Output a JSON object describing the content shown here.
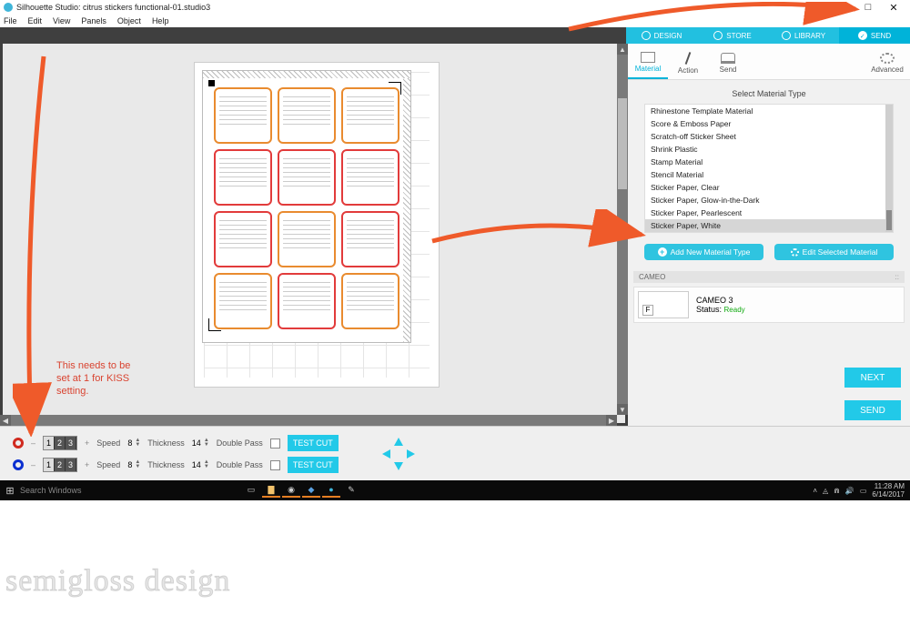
{
  "title": "Silhouette Studio: citrus stickers functional-01.studio3",
  "menubar": [
    "File",
    "Edit",
    "View",
    "Panels",
    "Object",
    "Help"
  ],
  "nav_tabs": [
    "DESIGN",
    "STORE",
    "LIBRARY",
    "SEND"
  ],
  "panel_tabs": {
    "material": "Material",
    "action": "Action",
    "send": "Send",
    "advanced": "Advanced"
  },
  "material": {
    "header": "Select Material Type",
    "items": [
      "Rhinestone Template Material",
      "Score & Emboss Paper",
      "Scratch-off Sticker Sheet",
      "Shrink Plastic",
      "Stamp Material",
      "Stencil Material",
      "Sticker Paper, Clear",
      "Sticker Paper, Glow-in-the-Dark",
      "Sticker Paper, Pearlescent",
      "Sticker Paper, White"
    ],
    "selected_index": 9,
    "add_btn": "Add New Material Type",
    "edit_btn": "Edit Selected Material"
  },
  "device": {
    "bar": "CAMEO",
    "name": "CAMEO 3",
    "status_label": "Status:",
    "status": "Ready",
    "thumb_letter": "F"
  },
  "buttons": {
    "next": "NEXT",
    "send": "SEND",
    "test": "TEST CUT"
  },
  "passes": [
    {
      "color": "#d02a1f",
      "selector": "1",
      "speed_label": "Speed",
      "speed": "8",
      "thick_label": "Thickness",
      "thick": "14",
      "double_label": "Double Pass"
    },
    {
      "color": "#0b2fd0",
      "selector": "1",
      "speed_label": "Speed",
      "speed": "8",
      "thick_label": "Thickness",
      "thick": "14",
      "double_label": "Double Pass"
    }
  ],
  "taskbar": {
    "search": "Search Windows",
    "time": "11:28 AM",
    "date": "6/14/2017"
  },
  "annotation": {
    "text": "This needs to be\nset at 1 for KISS\nsetting."
  },
  "sticker_colors": [
    "#e98b2f",
    "#e98b2f",
    "#e98b2f",
    "#e23b3b",
    "#e23b3b",
    "#e23b3b",
    "#e23b3b",
    "#e98b2f",
    "#e23b3b",
    "#e98b2f",
    "#e23b3b",
    "#e98b2f"
  ],
  "watermark": "semigloss design"
}
